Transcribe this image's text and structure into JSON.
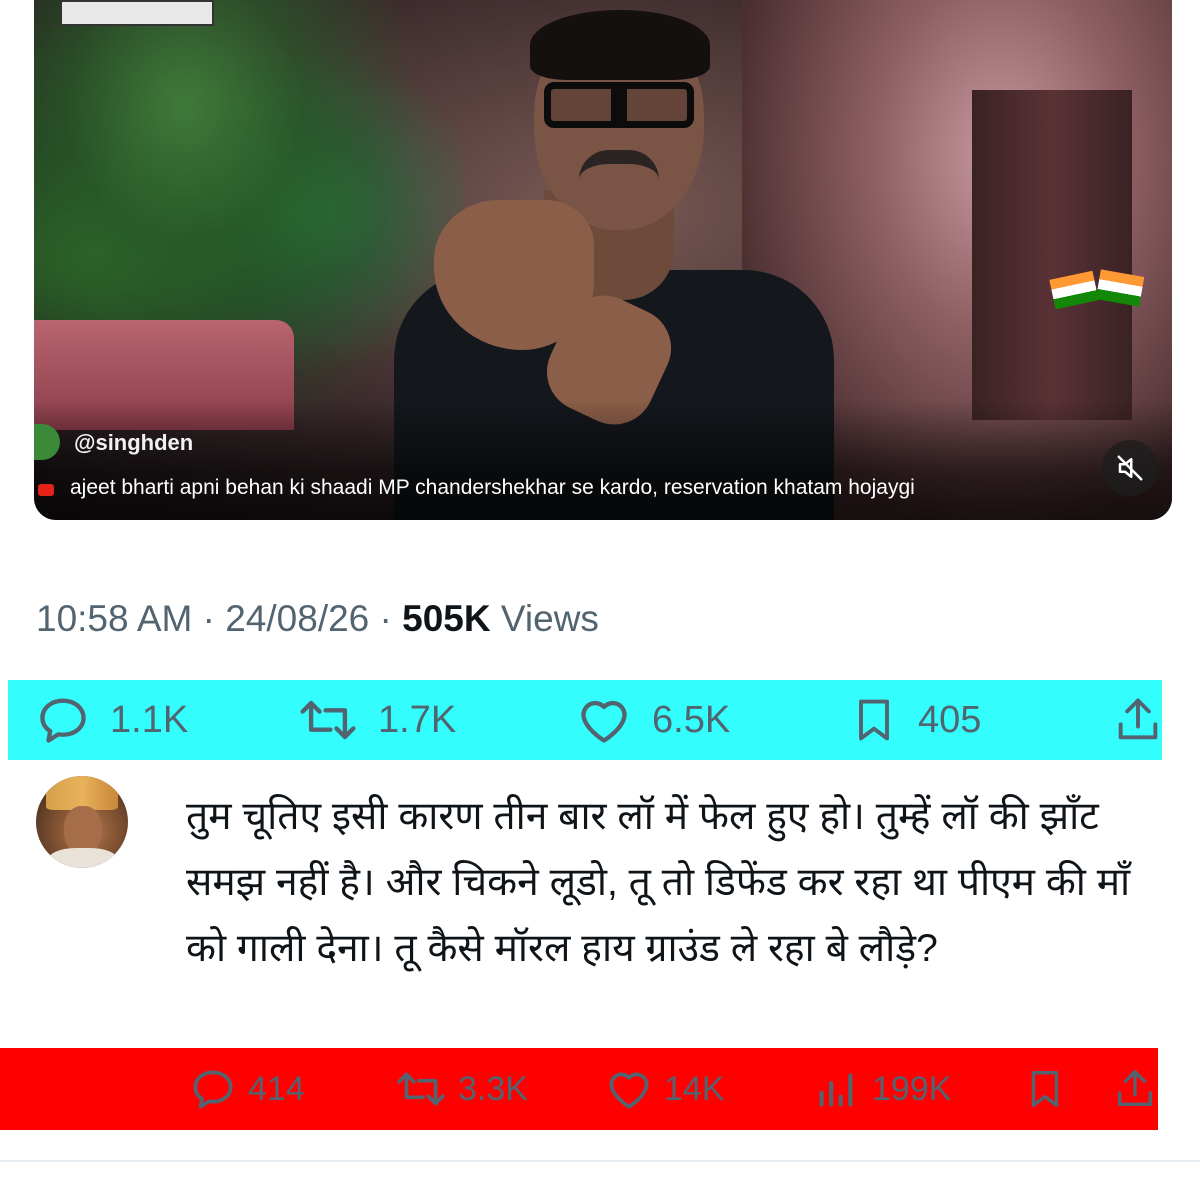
{
  "video": {
    "handle": "@singhden",
    "caption": "ajeet bharti apni behan ki shaadi MP chandershekhar se kardo, reservation khatam hojaygi",
    "mute_icon": "muted-speaker-icon"
  },
  "tweet_meta": {
    "time": "10:58 AM",
    "sep1": " · ",
    "date": "24/08/26",
    "sep2": " · ",
    "views_count": "505K",
    "views_label": " Views"
  },
  "tweet_actions": {
    "highlight_color": "#33fdfd",
    "replies": "1.1K",
    "retweets": "1.7K",
    "likes": "6.5K",
    "bookmarks": "405"
  },
  "reply": {
    "text": "तुम चूतिए इसी कारण तीन बार लॉ में फेल हुए हो। तुम्हें लॉ की झाँट समझ नहीं है। और चिकने लूडो, तू तो डिफेंड कर रहा था पीएम की माँ को गाली देना। तू कैसे मॉरल हाय ग्राउंड ले रहा बे लौड़े?",
    "actions": {
      "highlight_color": "#ff0000",
      "replies": "414",
      "retweets": "3.3K",
      "likes": "14K",
      "views": "199K"
    }
  }
}
